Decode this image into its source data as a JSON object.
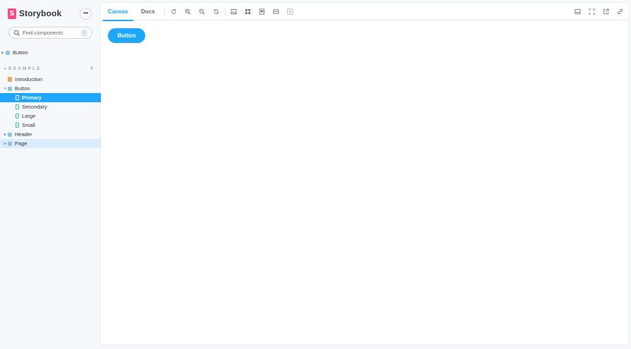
{
  "app": {
    "brand": "Storybook",
    "brand_mark": "S",
    "menu_label": "•••"
  },
  "search": {
    "placeholder": "Find components",
    "shortcut": "/"
  },
  "sidebar": {
    "root_item": "Button",
    "section_title": "EXAMPLE",
    "section_toggle": "⇕",
    "items": [
      {
        "label": "Introduction",
        "icon": "doc-icon"
      },
      {
        "label": "Button",
        "icon": "component-icon",
        "expanded": true
      },
      {
        "label": "Primary",
        "icon": "story-icon",
        "selected": true
      },
      {
        "label": "Secondary",
        "icon": "story-icon"
      },
      {
        "label": "Large",
        "icon": "story-icon"
      },
      {
        "label": "Small",
        "icon": "story-icon"
      },
      {
        "label": "Header",
        "icon": "component-icon"
      },
      {
        "label": "Page",
        "icon": "component-icon"
      }
    ]
  },
  "toolbar": {
    "tabs": [
      {
        "label": "Canvas",
        "active": true
      },
      {
        "label": "Docs",
        "active": false
      }
    ],
    "tools": [
      "reload-icon",
      "zoom-in-icon",
      "zoom-out-icon",
      "zoom-reset-icon",
      "background-icon",
      "grid-icon",
      "viewport-icon",
      "measure-icon",
      "outline-icon"
    ],
    "right_tools": [
      "panel-toggle-icon",
      "fullscreen-icon",
      "open-new-tab-icon",
      "copy-link-icon"
    ]
  },
  "canvas": {
    "button_label": "Button"
  },
  "colors": {
    "accent": "#1ea7fd",
    "brand": "#ff4785",
    "sidebar_bg": "#f6f9fc"
  }
}
